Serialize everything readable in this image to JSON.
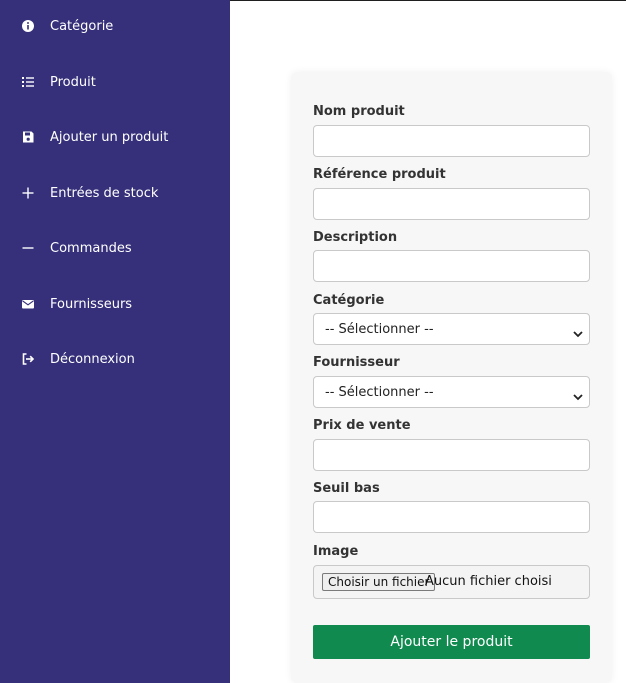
{
  "sidebar": {
    "items": [
      {
        "label": "Catégorie",
        "icon": "info-circle-icon"
      },
      {
        "label": "Produit",
        "icon": "list-icon"
      },
      {
        "label": "Ajouter un produit",
        "icon": "save-icon"
      },
      {
        "label": "Entrées de stock",
        "icon": "plus-icon"
      },
      {
        "label": "Commandes",
        "icon": "minus-icon"
      },
      {
        "label": "Fournisseurs",
        "icon": "envelope-icon"
      },
      {
        "label": "Déconnexion",
        "icon": "sign-out-icon"
      }
    ]
  },
  "form": {
    "fields": {
      "nom": {
        "label": "Nom produit",
        "value": ""
      },
      "reference": {
        "label": "Référence produit",
        "value": ""
      },
      "description": {
        "label": "Description",
        "value": ""
      },
      "categorie": {
        "label": "Catégorie",
        "selected": "-- Sélectionner --"
      },
      "fournisseur": {
        "label": "Fournisseur",
        "selected": "-- Sélectionner --"
      },
      "prix": {
        "label": "Prix de vente",
        "value": ""
      },
      "seuil": {
        "label": "Seuil bas",
        "value": ""
      },
      "image": {
        "label": "Image",
        "button": "Choisir un fichier",
        "status": "Aucun fichier choisi"
      }
    },
    "submit_label": "Ajouter le produit"
  },
  "colors": {
    "sidebar": "#36307a",
    "submit": "#118a4f"
  }
}
